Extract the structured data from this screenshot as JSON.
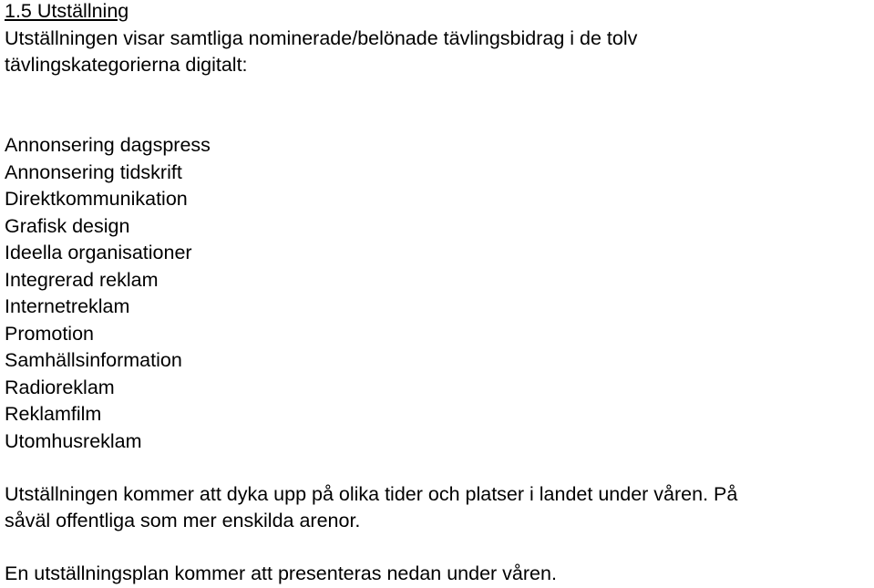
{
  "heading": "1.5 Utställning",
  "intro": {
    "line1": "Utställningen visar samtliga nominerade/belönade tävlingsbidrag i de tolv",
    "line2": "tävlingskategorierna digitalt:"
  },
  "categories": [
    "Annonsering dagspress",
    "Annonsering tidskrift",
    "Direktkommunikation",
    "Grafisk design",
    "Ideella organisationer",
    "Integrerad reklam",
    "Internetreklam",
    "Promotion",
    "Samhällsinformation",
    "Radioreklam",
    "Reklamfilm",
    "Utomhusreklam"
  ],
  "paragraph2": {
    "line1": "Utställningen kommer att dyka upp på olika tider och platser i landet under våren. På",
    "line2": "såväl offentliga som mer enskilda arenor."
  },
  "paragraph3": {
    "line1": "En utställningsplan kommer att presenteras nedan under våren."
  }
}
